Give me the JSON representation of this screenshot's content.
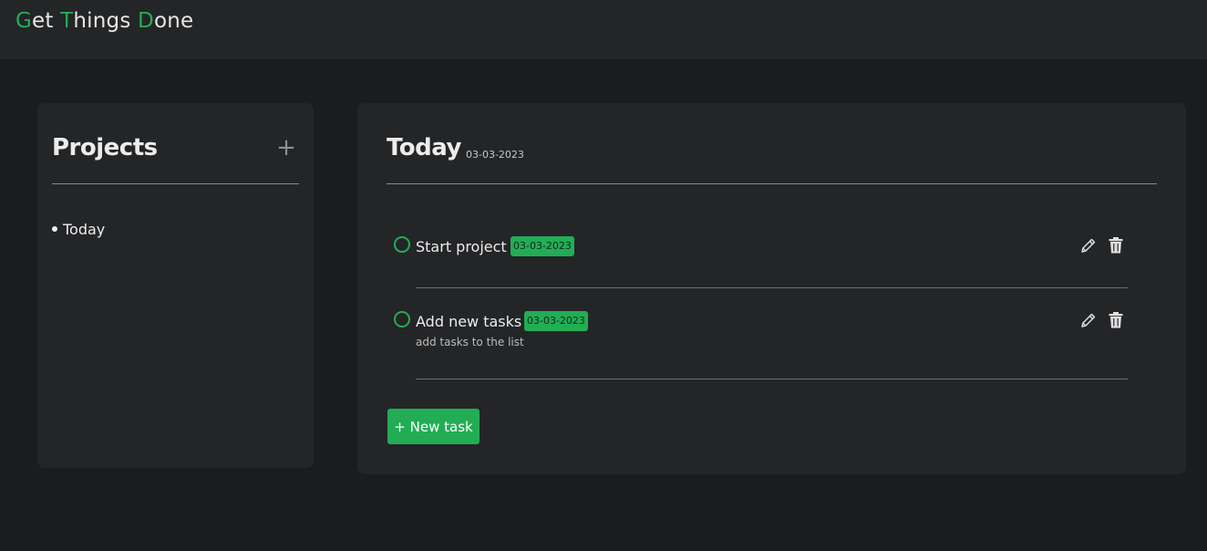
{
  "app": {
    "logo_parts": [
      "G",
      "et ",
      "T",
      "hings ",
      "D",
      "one"
    ]
  },
  "colors": {
    "accent": "#22ad55",
    "background": "#1b1c1e",
    "panel": "#242527"
  },
  "sidebar": {
    "title": "Projects",
    "add_icon": "plus-icon",
    "items": [
      {
        "label": "Today"
      }
    ]
  },
  "main": {
    "title": "Today",
    "date": "03-03-2023",
    "tasks": [
      {
        "title": "Start project",
        "due": "03-03-2023",
        "description": "",
        "edit_icon": "pencil-icon",
        "delete_icon": "trash-icon"
      },
      {
        "title": "Add new tasks",
        "due": "03-03-2023",
        "description": "add tasks to the list",
        "edit_icon": "pencil-icon",
        "delete_icon": "trash-icon"
      }
    ],
    "new_task_label": "+ New task"
  }
}
